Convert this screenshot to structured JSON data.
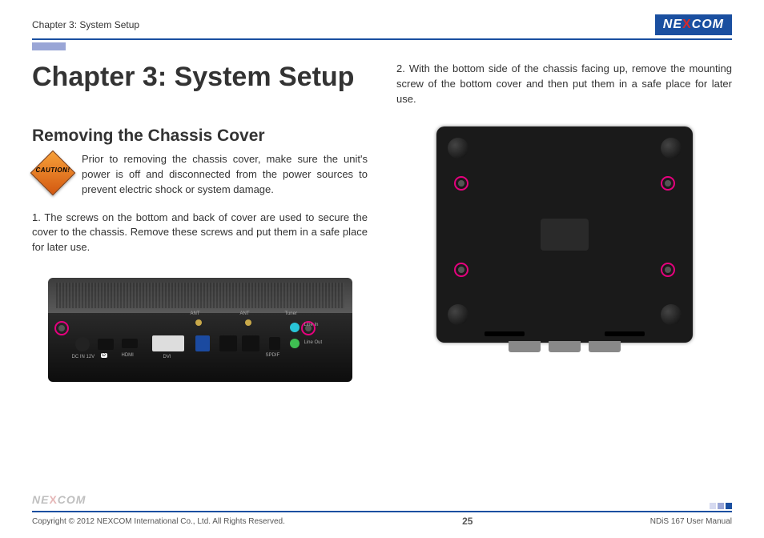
{
  "header": {
    "breadcrumb": "Chapter 3: System Setup",
    "brand_prefix": "NE",
    "brand_x": "X",
    "brand_suffix": "COM"
  },
  "content": {
    "chapter_title": "Chapter 3: System Setup",
    "section_title": "Removing the Chassis Cover",
    "caution_label": "CAUTION!",
    "caution_text": "Prior to removing the chassis cover, make sure the unit's power is off and disconnected from the power sources to prevent electric shock or system damage.",
    "step1": "1.  The screws on the bottom and back of cover are used to secure the cover to the chassis. Remove these screws and put them in a safe place for later use.",
    "step2": "2.  With the bottom side of the chassis facing up, remove the mounting screw of the bottom cover and then put them in a safe place for later use.",
    "rear_labels": {
      "dcin": "DC IN 12V",
      "hdmi": "HDMI",
      "dvi": "DVI",
      "ant1": "ANT",
      "ant2": "ANT",
      "tuner": "Tuner",
      "line_in": "Line In",
      "line_out": "Line Out",
      "spdif": "SPDIF",
      "dp": "D"
    }
  },
  "footer": {
    "copyright": "Copyright © 2012 NEXCOM International Co., Ltd. All Rights Reserved.",
    "page": "25",
    "doc": "NDiS 167 User Manual",
    "brand_prefix": "NE",
    "brand_x": "X",
    "brand_suffix": "COM"
  }
}
